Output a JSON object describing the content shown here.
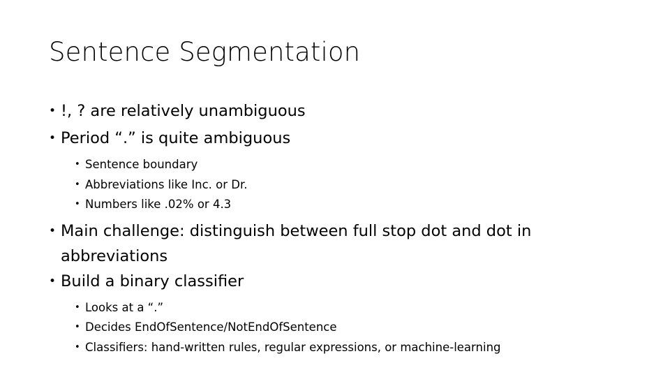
{
  "slide": {
    "title": "Sentence Segmentation",
    "background_color": "#ffffff",
    "text_color": "#000000",
    "bullet_glyph": "•",
    "content": [
      {
        "level": 1,
        "text": "!, ? are relatively unambiguous"
      },
      {
        "level": 1,
        "text": "Period “.” is quite ambiguous"
      },
      {
        "level": 2,
        "text": "Sentence boundary"
      },
      {
        "level": 2,
        "text": "Abbreviations like Inc. or Dr."
      },
      {
        "level": 2,
        "text": "Numbers like .02% or 4.3"
      },
      {
        "level": 1,
        "text": "Main challenge: distinguish between full stop dot and dot in abbreviations"
      },
      {
        "level": 1,
        "text": "Build a binary classifier"
      },
      {
        "level": 2,
        "text": "Looks at a “.”"
      },
      {
        "level": 2,
        "text": "Decides EndOfSentence/NotEndOfSentence"
      },
      {
        "level": 2,
        "text": "Classifiers: hand-written rules, regular expressions, or machine-learning"
      }
    ]
  }
}
